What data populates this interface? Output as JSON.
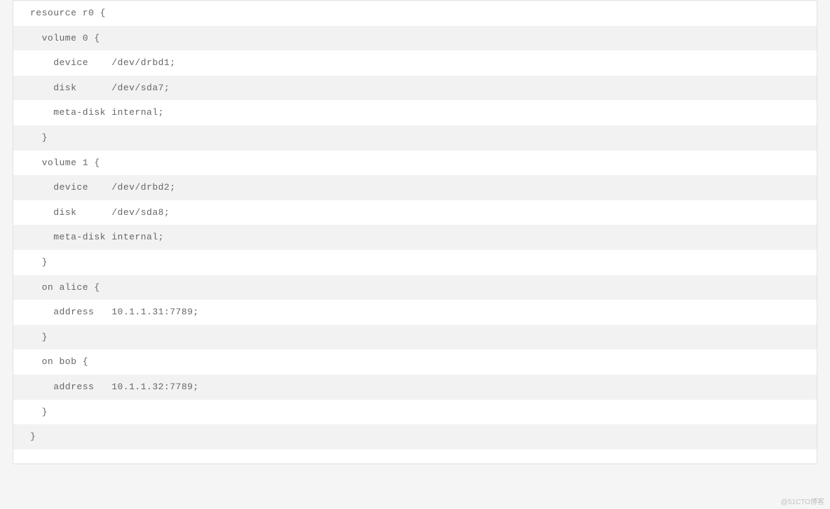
{
  "lines": [
    "resource r0 {",
    "  volume 0 {",
    "    device    /dev/drbd1;",
    "    disk      /dev/sda7;",
    "    meta-disk internal;",
    "  }",
    "  volume 1 {",
    "    device    /dev/drbd2;",
    "    disk      /dev/sda8;",
    "    meta-disk internal;",
    "  }",
    "  on alice {",
    "    address   10.1.1.31:7789;",
    "  }",
    "  on bob {",
    "    address   10.1.1.32:7789;",
    "  }",
    "}",
    ""
  ],
  "watermark": "@51CTO博客"
}
